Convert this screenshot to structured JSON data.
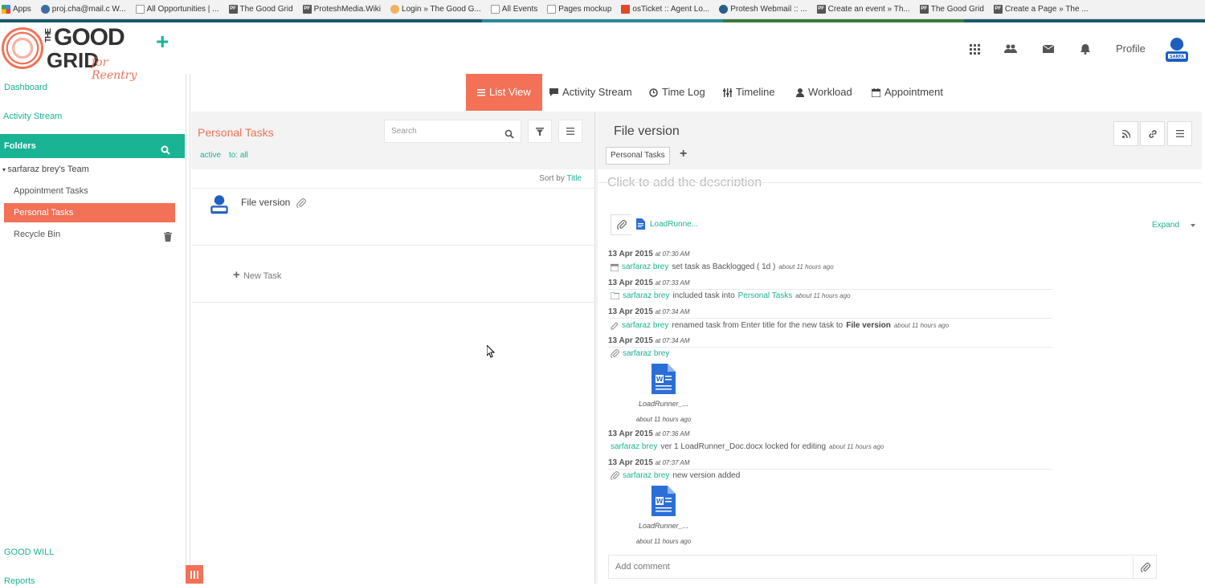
{
  "bookmarks": [
    "Apps",
    "proj.cha@mail.c W...",
    "All Opportunities | ...",
    "The Good Grid",
    "ProteshMedia.Wiki",
    "Login » The Good G...",
    "All Events",
    "Pages mockup",
    "osTicket :: Agent Lo...",
    "Protesh Webmail :: ...",
    "Create an event » Th...",
    "The Good Grid",
    "Create a Page » The ..."
  ],
  "brand": {
    "logo_line1": "GOOD",
    "logo_prefix": "THE",
    "logo_line2": "GRID",
    "logo_tagline": "for Reentry",
    "accent": "#1ab394",
    "brand_color": "#f27157"
  },
  "header": {
    "add_label": "+",
    "profile_label": "Profile",
    "avatar_text": "SARFA"
  },
  "sidebar": {
    "dashboard": "Dashboard",
    "activity_stream": "Activity Stream",
    "folders_label": "Folders",
    "team": "sarfaraz brey's Team",
    "items": [
      "Appointment Tasks",
      "Personal Tasks",
      "Recycle Bin"
    ],
    "footer_links": [
      "GOOD WILL",
      "Reports"
    ]
  },
  "tabs": [
    "List View",
    "Activity Stream",
    "Time Log",
    "Timeline",
    "Workload",
    "Appointment"
  ],
  "list": {
    "title": "Personal Tasks",
    "search_placeholder": "Search",
    "filter_active": "active",
    "filter_to": "to: all",
    "sort_prefix": "Sort by",
    "sort_value": "Title",
    "task_name": "File version",
    "new_task": "New Task"
  },
  "detail": {
    "title": "File version",
    "chip": "Personal Tasks",
    "description_placeholder": "Click to add the description",
    "attachment_name": "LoadRunne...",
    "expand_label": "Expand",
    "comment_placeholder": "Add comment",
    "activity": [
      {
        "date": "13 Apr 2015",
        "time": "at 07:30 AM",
        "user": "sarfaraz brey",
        "text": "set task as Backlogged ( 1d )",
        "ago": "about 11 hours ago"
      },
      {
        "date": "13 Apr 2015",
        "time": "at 07:33 AM",
        "user": "sarfaraz brey",
        "text": "included task into",
        "link": "Personal Tasks",
        "ago": "about 11 hours ago"
      },
      {
        "date": "13 Apr 2015",
        "time": "at 07:34 AM",
        "user": "sarfaraz brey",
        "text": "renamed task from Enter title for the new task to",
        "bold": "File version",
        "ago": "about 11 hours ago"
      },
      {
        "date": "13 Apr 2015",
        "time": "at 07:34 AM",
        "user": "sarfaraz brey",
        "file": "LoadRunner_...",
        "ago": "about 11 hours ago"
      },
      {
        "date": "13 Apr 2015",
        "time": "at 07:36 AM",
        "user": "sarfaraz brey",
        "text": "ver 1 LoadRunner_Doc.docx locked for editing",
        "ago": "about 11 hours ago"
      },
      {
        "date": "13 Apr 2015",
        "time": "at 07:37 AM",
        "user": "sarfaraz brey",
        "text": "new version added",
        "file": "LoadRunner_...",
        "ago": "about 11 hours ago"
      }
    ]
  }
}
